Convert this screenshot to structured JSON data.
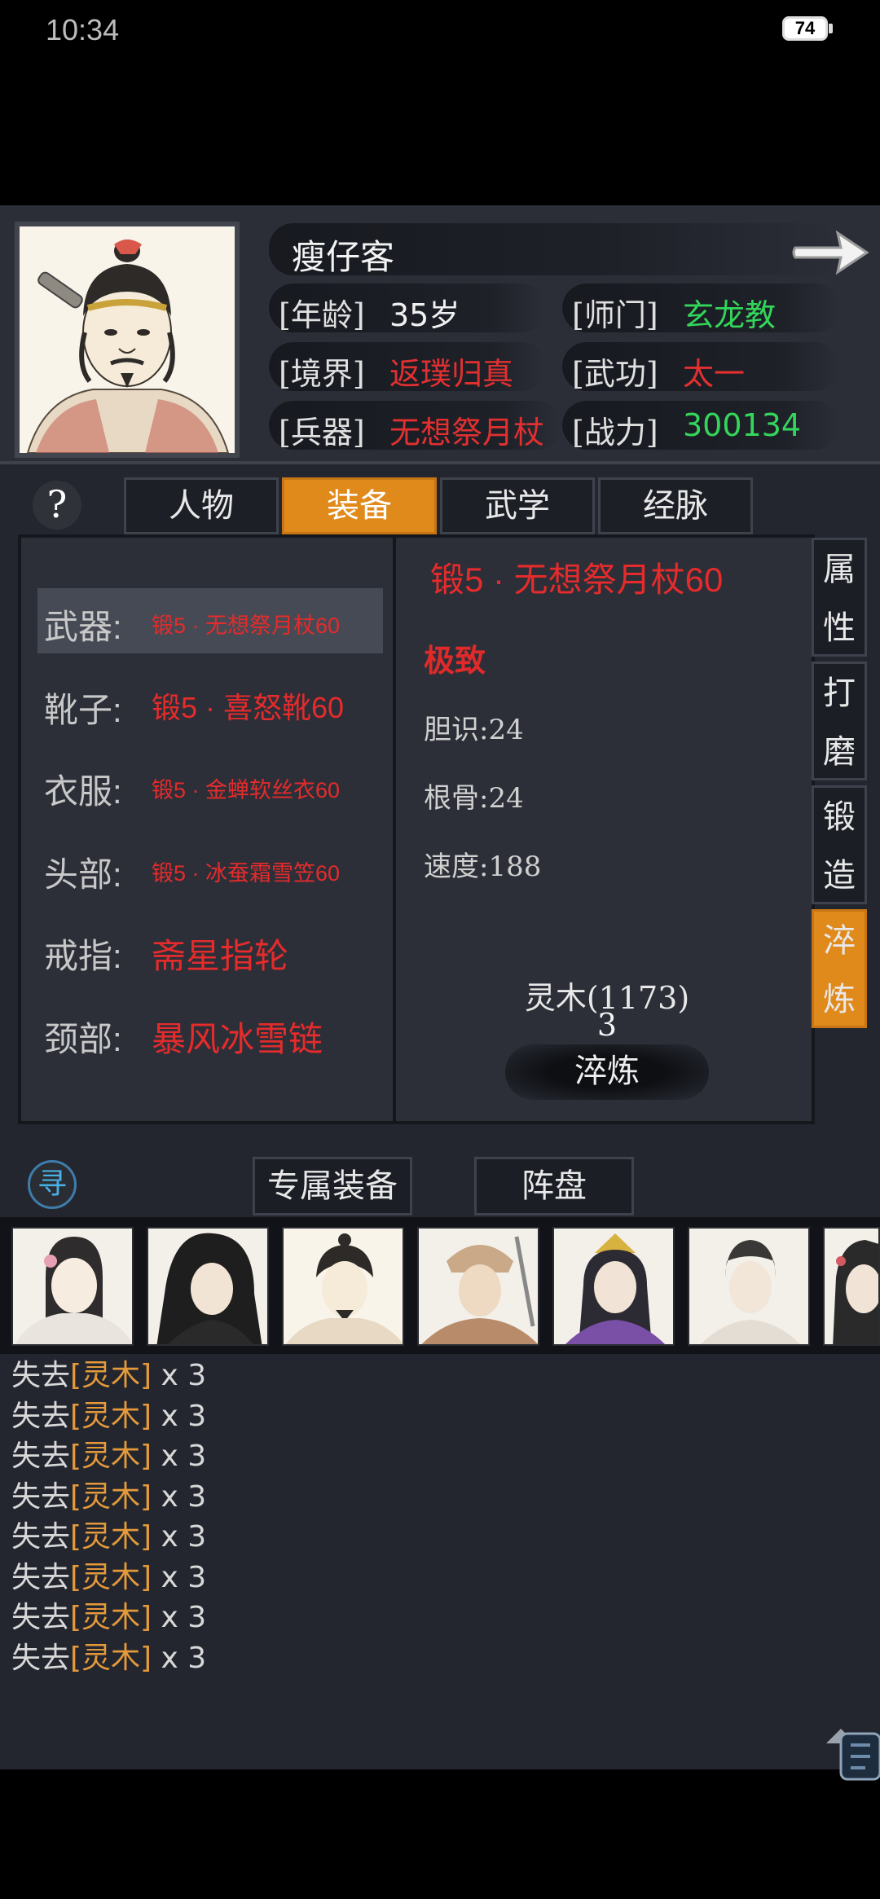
{
  "status": {
    "time": "10:34",
    "battery": "74"
  },
  "character": {
    "name": "瘦仔客",
    "info": [
      {
        "label": "[年龄]",
        "value": "35岁",
        "color": "white"
      },
      {
        "label": "[师门]",
        "value": "玄龙教",
        "color": "green"
      },
      {
        "label": "[境界]",
        "value": "返璞归真",
        "color": "red"
      },
      {
        "label": "[武功]",
        "value": "太一",
        "color": "red"
      },
      {
        "label": "[兵器]",
        "value": "无想祭月杖",
        "color": "red"
      },
      {
        "label": "[战力]",
        "value": "300134",
        "color": "green"
      }
    ]
  },
  "tabs": [
    "人物",
    "装备",
    "武学",
    "经脉"
  ],
  "active_tab": "装备",
  "help": "?",
  "equipment": [
    {
      "slot": "武器:",
      "name": "锻5 · 无想祭月杖60"
    },
    {
      "slot": "靴子:",
      "name": "锻5 · 喜怒靴60"
    },
    {
      "slot": "衣服:",
      "name": "锻5 · 金蝉软丝衣60"
    },
    {
      "slot": "头部:",
      "name": "锻5 · 冰蚕霜雪笠60"
    },
    {
      "slot": "戒指:",
      "name": "斋星指轮"
    },
    {
      "slot": "颈部:",
      "name": "暴风冰雪链"
    }
  ],
  "detail": {
    "title": "锻5 · 无想祭月杖60",
    "grade": "极致",
    "stats": [
      "胆识:24",
      "根骨:24",
      "速度:188"
    ],
    "material": "灵木(1173)",
    "material_count": "3",
    "action": "淬炼"
  },
  "side_tabs": [
    {
      "chars": [
        "属",
        "性"
      ]
    },
    {
      "chars": [
        "打",
        "磨"
      ]
    },
    {
      "chars": [
        "锻",
        "造"
      ]
    },
    {
      "chars": [
        "淬",
        "炼"
      ]
    }
  ],
  "active_side_tab": 3,
  "bottom_buttons": [
    "专属装备",
    "阵盘"
  ],
  "seek_icon": "寻",
  "log": {
    "prefix": "失去",
    "item": "[灵木]",
    "suffix": " x 3",
    "count": 8
  }
}
